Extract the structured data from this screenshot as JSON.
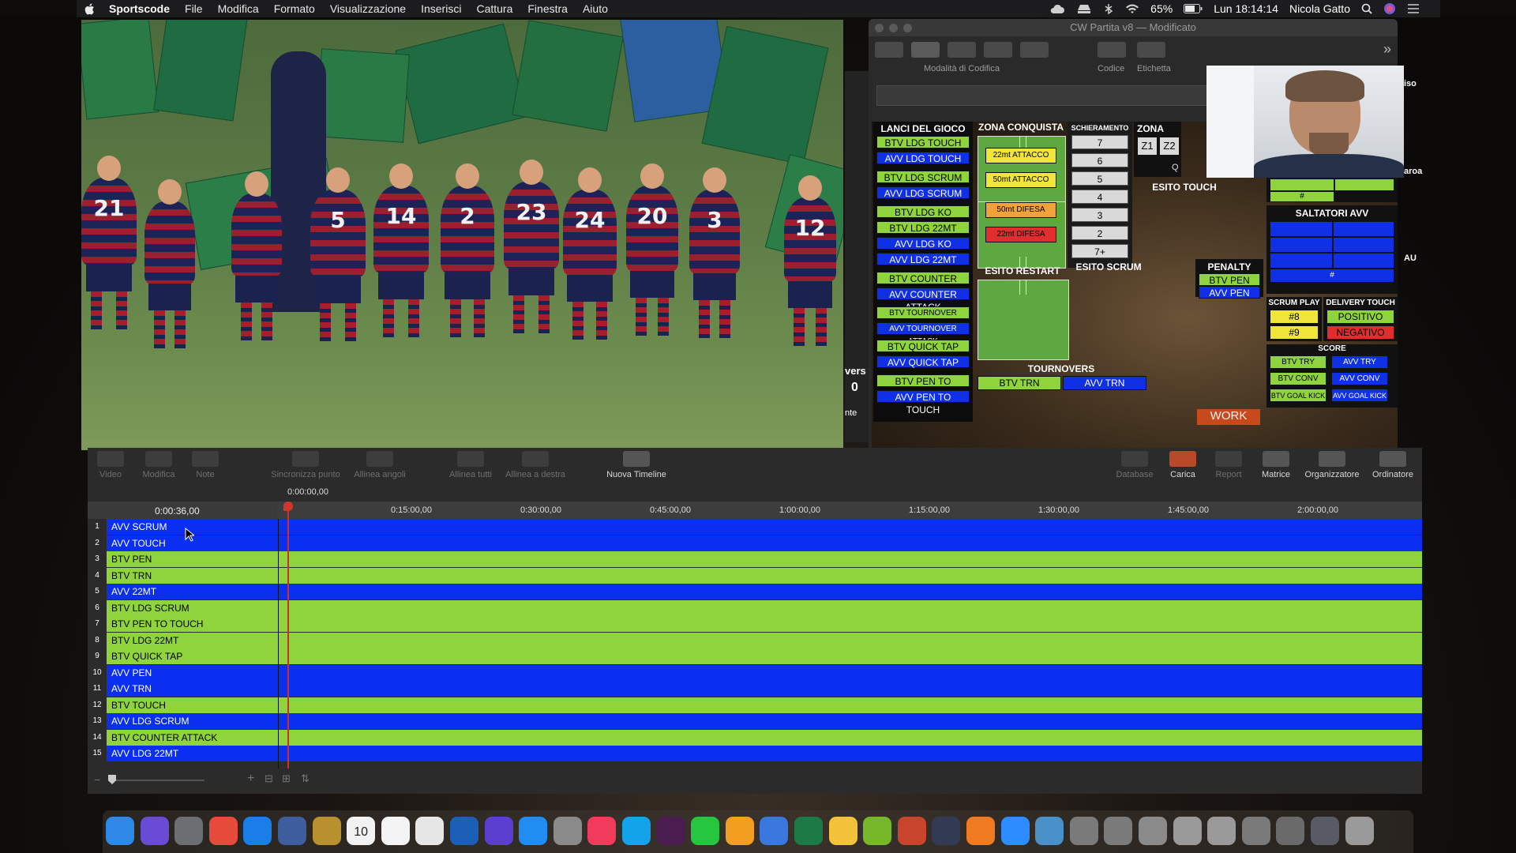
{
  "menubar": {
    "app": "Sportscode",
    "items": [
      "File",
      "Modifica",
      "Formato",
      "Visualizzazione",
      "Inserisci",
      "Cattura",
      "Finestra",
      "Aiuto"
    ],
    "battery": "65%",
    "clock": "Lun 18:14:14",
    "user": "Nicola Gatto"
  },
  "video": {
    "jersey_numbers": [
      "21",
      "5",
      "14",
      "2",
      "23",
      "24",
      "20",
      "3",
      "12"
    ]
  },
  "code_window": {
    "title": "CW Partita v8 — Modificato",
    "toolbar_labels": {
      "mode": "Modalità di Codifica",
      "code": "Codice",
      "label": "Etichetta"
    },
    "side_texts": {
      "t1": "iso",
      "t2": "aroa",
      "t3": "AU",
      "t4": "vers",
      "t5": "0",
      "t6": "nte"
    },
    "lanci": {
      "header": "LANCI DEL GIOCO",
      "buttons": [
        {
          "text": "BTV LDG TOUCH",
          "c": "g"
        },
        {
          "text": "AVV LDG TOUCH",
          "c": "b"
        },
        {
          "text": "BTV LDG SCRUM",
          "c": "g"
        },
        {
          "text": "AVV LDG SCRUM",
          "c": "b"
        },
        {
          "text": "BTV LDG KO",
          "c": "g"
        },
        {
          "text": "BTV LDG 22MT",
          "c": "g"
        },
        {
          "text": "AVV LDG KO",
          "c": "b"
        },
        {
          "text": "AVV LDG 22MT",
          "c": "b"
        },
        {
          "text": "BTV COUNTER ATTACK",
          "c": "g"
        },
        {
          "text": "AVV COUNTER ATTACK",
          "c": "b"
        },
        {
          "text": "BTV TOURNOVER ATTACK",
          "c": "g"
        },
        {
          "text": "AVV TOURNOVER ATTACK",
          "c": "b"
        },
        {
          "text": "BTV QUICK TAP",
          "c": "g"
        },
        {
          "text": "AVV QUICK TAP",
          "c": "b"
        },
        {
          "text": "BTV PEN TO TOUCH",
          "c": "g"
        },
        {
          "text": "AVV PEN TO TOUCH",
          "c": "b"
        }
      ]
    },
    "zona_conquista": {
      "header": "ZONA CONQUISTA",
      "b1": "22mt ATTACCO",
      "b2": "50mt ATTACCO",
      "b3": "50mt DIFESA",
      "b4": "22mt DIFESA"
    },
    "schieramento": {
      "header": "SCHIERAMENTO",
      "values": [
        "7",
        "6",
        "5",
        "4",
        "3",
        "2",
        "7+"
      ]
    },
    "zona": {
      "header": "ZONA",
      "z1": "Z1",
      "z2": "Z2",
      "q": "Q"
    },
    "esito_touch": "ESITO TOUCH",
    "esito_restart": "ESITO RESTART",
    "esito_scrum": "ESITO SCRUM",
    "penalty": {
      "header": "PENALTY",
      "btv": "BTV PEN",
      "avv": "AVV PEN"
    },
    "saltatori": {
      "header": "SALTATORI AVV",
      "hash": "#"
    },
    "green_hash": "#",
    "scrum_play": {
      "header": "SCRUM PLAY",
      "a": "#8",
      "b": "#9"
    },
    "delivery_touch": {
      "header": "DELIVERY TOUCH",
      "pos": "POSITIVO",
      "neg": "NEGATIVO"
    },
    "tournovers": {
      "header": "TOURNOVERS",
      "btv": "BTV TRN",
      "avv": "AVV TRN"
    },
    "score": {
      "header": "SCORE",
      "btv_try": "BTV TRY",
      "avv_try": "AVV TRY",
      "btv_conv": "BTV CONV",
      "avv_conv": "AVV CONV",
      "btv_gk": "BTV GOAL KICK",
      "avv_gk": "AVV GOAL KICK"
    },
    "work": "WORK"
  },
  "timeline": {
    "tools_left": [
      "Video",
      "Modifica",
      "Note",
      "Sincronizza punto",
      "Allinea angoli",
      "Allinea tutti",
      "Allinea a destra",
      "Nuova Timeline"
    ],
    "tools_right": [
      "Database",
      "Carica",
      "Report",
      "Matrice",
      "Organizzatore",
      "Ordinatore"
    ],
    "current_time": "0:00:36,00",
    "start_time": "0:00:00,00",
    "ticks": [
      "0:15:00,00",
      "0:30:00,00",
      "0:45:00,00",
      "1:00:00,00",
      "1:15:00,00",
      "1:30:00,00",
      "1:45:00,00",
      "2:00:00,00"
    ],
    "rows": [
      {
        "n": "1",
        "label": "AVV SCRUM",
        "c": "b"
      },
      {
        "n": "2",
        "label": "AVV TOUCH",
        "c": "b"
      },
      {
        "n": "3",
        "label": "BTV PEN",
        "c": "g"
      },
      {
        "n": "4",
        "label": "BTV TRN",
        "c": "g"
      },
      {
        "n": "5",
        "label": "AVV 22MT",
        "c": "b"
      },
      {
        "n": "6",
        "label": "BTV LDG SCRUM",
        "c": "g"
      },
      {
        "n": "7",
        "label": "BTV PEN TO TOUCH",
        "c": "g"
      },
      {
        "n": "8",
        "label": "BTV LDG 22MT",
        "c": "g"
      },
      {
        "n": "9",
        "label": "BTV QUICK TAP",
        "c": "g"
      },
      {
        "n": "10",
        "label": "AVV PEN",
        "c": "b"
      },
      {
        "n": "11",
        "label": "AVV TRN",
        "c": "b"
      },
      {
        "n": "12",
        "label": "BTV TOUCH",
        "c": "g"
      },
      {
        "n": "13",
        "label": "AVV LDG SCRUM",
        "c": "b"
      },
      {
        "n": "14",
        "label": "BTV COUNTER ATTACK",
        "c": "g"
      },
      {
        "n": "15",
        "label": "AVV LDG 22MT",
        "c": "b"
      }
    ]
  },
  "dock": {
    "calendar_day": "10",
    "apps": [
      "finder-icon",
      "siri-icon",
      "launchpad-icon",
      "chrome-icon",
      "safari-icon",
      "preview-icon",
      "notes-icon",
      "calendar-icon",
      "textedit-icon",
      "numbers-icon",
      "browser-icon",
      "imovie-icon",
      "appstore-icon",
      "system-preferences-icon",
      "music-icon",
      "skype-icon",
      "slack-icon",
      "whatsapp-icon",
      "pages-icon",
      "keynote-icon",
      "excel-icon",
      "presentation-icon",
      "android-file-icon",
      "tools-icon",
      "sportscode-icon",
      "sketch-icon",
      "zoom-icon",
      "folder-icon",
      "stack1-icon",
      "stack2-icon",
      "stack3-icon",
      "stack4-icon",
      "stack5-icon",
      "stack6-icon",
      "stack7-icon",
      "screen-icon",
      "trash-icon"
    ],
    "colors": [
      "#2e88e8",
      "#6a4bd6",
      "#6d6d74",
      "#e64a3b",
      "#1a7ee8",
      "#3d5d9c",
      "#b9902e",
      "#f2f2f2",
      "#f4f4f4",
      "#e6e6e6",
      "#1c5fb8",
      "#5a3ed0",
      "#1f8df2",
      "#8a8a8a",
      "#f23a5d",
      "#12a3ea",
      "#4a1c4f",
      "#27c63f",
      "#f29e1f",
      "#3a78e0",
      "#1d7a44",
      "#f3c23a",
      "#76b82a",
      "#c8442c",
      "#333b52",
      "#f07a21",
      "#2d8cff",
      "#4a90c8",
      "#7a7a7a",
      "#7a7a7a",
      "#8a8a8a",
      "#9a9a9a",
      "#9a9a9a",
      "#7a7a7a",
      "#6a6a6a",
      "#585a66",
      "#9a9a9a"
    ]
  }
}
